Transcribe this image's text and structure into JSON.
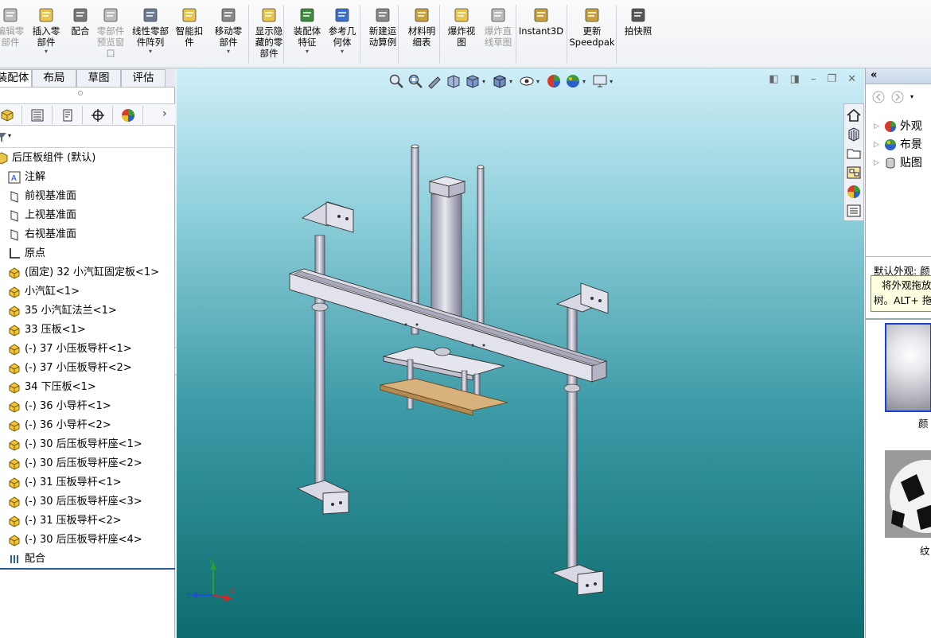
{
  "ribbon": {
    "buttons": [
      {
        "label": "编辑零\n部件",
        "disabled": true
      },
      {
        "label": "插入零\n部件",
        "caret": true
      },
      {
        "label": "配合"
      },
      {
        "label": "零部件\n预览窗\n口",
        "disabled": true
      },
      {
        "label": "线性零部\n件阵列",
        "caret": true
      },
      {
        "label": "智能扣\n件"
      },
      {
        "label": "移动零\n部件",
        "caret": true
      },
      {
        "label": "显示隐\n藏的零\n部件"
      },
      {
        "label": "装配体\n特征",
        "caret": true
      },
      {
        "label": "参考几\n何体",
        "caret": true
      },
      {
        "label": "新建运\n动算例"
      },
      {
        "label": "材料明\n细表"
      },
      {
        "label": "爆炸视\n图"
      },
      {
        "label": "爆炸直\n线草图",
        "disabled": true
      },
      {
        "label": "Instant3D"
      },
      {
        "label": "更新\nSpeedpak"
      },
      {
        "label": "拍快照"
      }
    ]
  },
  "tabs": [
    "装配体",
    "布局",
    "草图",
    "评估"
  ],
  "tree": {
    "root": "后压板组件  (默认)",
    "items": [
      {
        "label": "注解",
        "icon": "annotation"
      },
      {
        "label": "前视基准面",
        "icon": "plane"
      },
      {
        "label": "上视基准面",
        "icon": "plane"
      },
      {
        "label": "右视基准面",
        "icon": "plane"
      },
      {
        "label": "原点",
        "icon": "origin"
      },
      {
        "label": "(固定) 32 小汽缸固定板<1>",
        "icon": "part"
      },
      {
        "label": "小汽缸<1>",
        "icon": "part"
      },
      {
        "label": "35 小汽缸法兰<1>",
        "icon": "part"
      },
      {
        "label": "33 压板<1>",
        "icon": "part"
      },
      {
        "label": "(-) 37 小压板导杆<1>",
        "icon": "part"
      },
      {
        "label": "(-) 37 小压板导杆<2>",
        "icon": "part"
      },
      {
        "label": "34 下压板<1>",
        "icon": "part"
      },
      {
        "label": "(-) 36 小导杆<1>",
        "icon": "part"
      },
      {
        "label": "(-) 36 小导杆<2>",
        "icon": "part"
      },
      {
        "label": "(-) 30 后压板导杆座<1>",
        "icon": "part"
      },
      {
        "label": "(-) 30 后压板导杆座<2>",
        "icon": "part"
      },
      {
        "label": "(-) 31 压板导杆<1>",
        "icon": "part"
      },
      {
        "label": "(-) 30 后压板导杆座<3>",
        "icon": "part"
      },
      {
        "label": "(-) 31 压板导杆<2>",
        "icon": "part"
      },
      {
        "label": "(-) 30 后压板导杆座<4>",
        "icon": "part"
      },
      {
        "label": "配合",
        "icon": "mates"
      }
    ]
  },
  "rightpanel": {
    "nodes": [
      "外观",
      "布景",
      "贴图"
    ],
    "subtitle": "默认外观: 颜",
    "tooltip": [
      "将外观拖放",
      "树。ALT+ 拖"
    ],
    "swatches": [
      "颜",
      "纹"
    ]
  },
  "triad": {
    "x": "X",
    "y": "Y",
    "z": "Z"
  },
  "colors": {
    "viewport_top": "#cfeef8",
    "viewport_bottom": "#0c6c6e",
    "accent": "#2c5aa0",
    "plate": "#d7b27d"
  }
}
